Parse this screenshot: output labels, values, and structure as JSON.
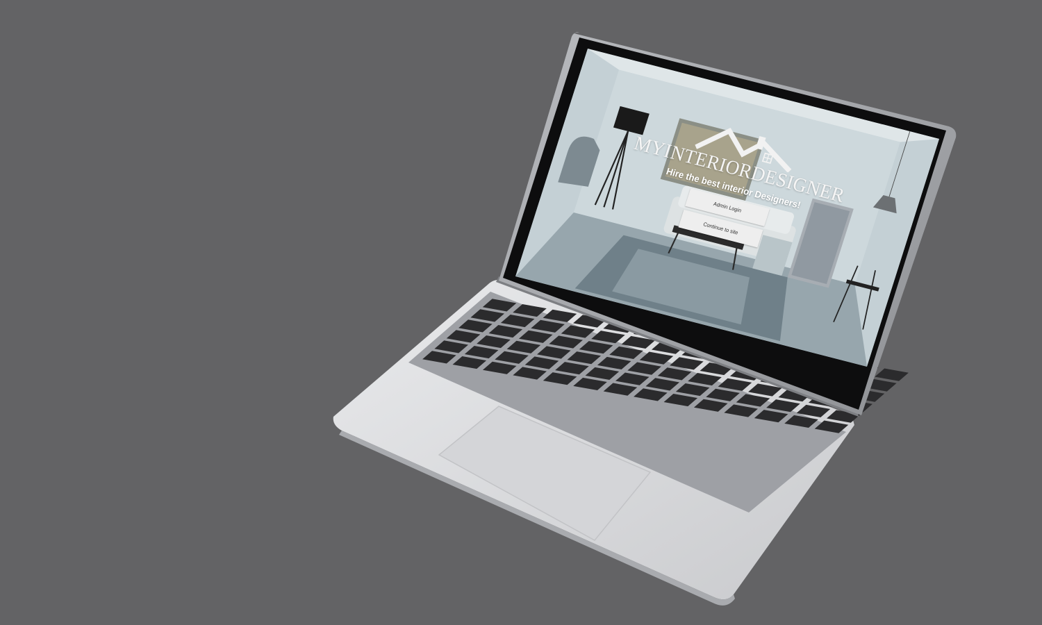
{
  "screen": {
    "logo_text": "MYINTERIORDESIGNER",
    "tagline": "Hire the best interior Designers!",
    "admin_login_label": "Admin Login",
    "continue_label": "Continue to site"
  },
  "colors": {
    "background": "#636365",
    "laptop_body": "#dcdde0",
    "keyboard_well": "#aeb0b4",
    "key": "#2b2b2d",
    "bezel": "#0d0d0e"
  }
}
